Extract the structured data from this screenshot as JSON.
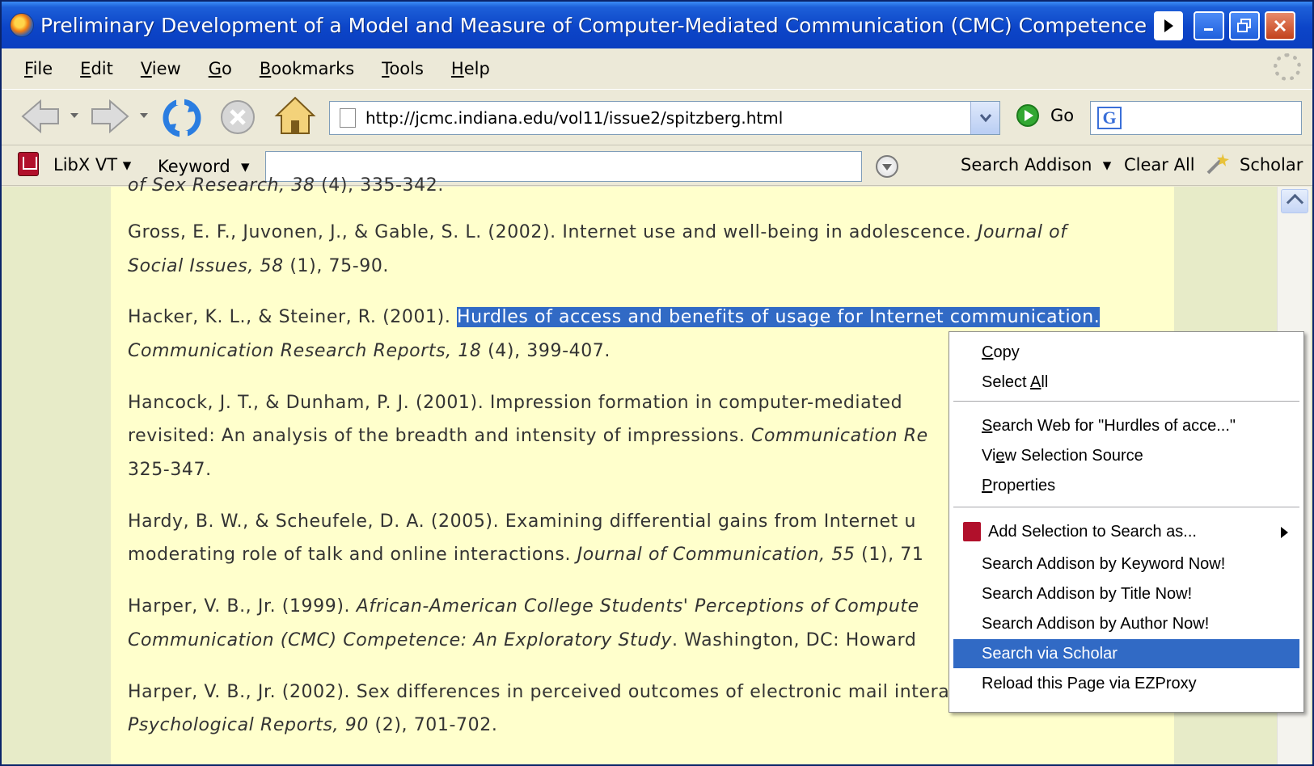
{
  "window": {
    "title": "Preliminary Development of a Model and Measure of Computer-Mediated Communication (CMC) Competence - M"
  },
  "menubar": {
    "items": [
      {
        "label": "File",
        "accel": "F",
        "rest": "ile"
      },
      {
        "label": "Edit",
        "accel": "E",
        "rest": "dit"
      },
      {
        "label": "View",
        "accel": "V",
        "rest": "iew"
      },
      {
        "label": "Go",
        "accel": "G",
        "rest": "o"
      },
      {
        "label": "Bookmarks",
        "accel": "B",
        "rest": "ookmarks"
      },
      {
        "label": "Tools",
        "accel": "T",
        "rest": "ools"
      },
      {
        "label": "Help",
        "accel": "H",
        "rest": "elp"
      }
    ]
  },
  "navbar": {
    "url": "http://jcmc.indiana.edu/vol11/issue2/spitzberg.html",
    "go_label": "Go",
    "google_icon_letter": "G"
  },
  "libx": {
    "edition": "LibX VT",
    "search_type": "Keyword",
    "search_value": "",
    "catalog_button": "Search Addison",
    "clear_all": "Clear All",
    "scholar": "Scholar"
  },
  "content": {
    "refs": [
      {
        "pre": "",
        "sel": "",
        "mid": "",
        "it": "of Sex Research, 38",
        "post": " (4), 335-342."
      },
      {
        "pre": "Gross, E. F., Juvonen, J., & Gable, S. L. (2002). Internet use and well-being in adolescence. ",
        "sel": "",
        "mid": "",
        "it": "Journal of",
        "post": ""
      },
      {
        "pre": "",
        "sel": "",
        "mid": "",
        "it": "Social Issues, 58",
        "post": " (1), 75-90."
      },
      {
        "pre": "Hacker, K. L., & Steiner, R. (2001). ",
        "sel": "Hurdles of access and benefits of usage for Internet communication.",
        "mid": "",
        "it": "",
        "post": ""
      },
      {
        "pre": "",
        "sel": "",
        "mid": "",
        "it": "Communication Research Reports, 18",
        "post": " (4), 399-407."
      },
      {
        "pre": "Hancock, J. T., & Dunham, P. J. (2001). Impression formation in computer-mediated",
        "sel": "",
        "mid": "",
        "it": "",
        "post": ""
      },
      {
        "pre": "revisited: An analysis of the breadth and intensity of impressions. ",
        "sel": "",
        "mid": "",
        "it": "Communication Re",
        "post": ""
      },
      {
        "pre": "325-347.",
        "sel": "",
        "mid": "",
        "it": "",
        "post": ""
      },
      {
        "pre": "Hardy, B. W., & Scheufele, D. A. (2005). Examining differential gains from Internet u",
        "sel": "",
        "mid": "",
        "it": "",
        "post": ""
      },
      {
        "pre": "moderating role of talk and online interactions. ",
        "sel": "",
        "mid": "",
        "it": "Journal of Communication, 55",
        "post": " (1), 71"
      },
      {
        "pre": "Harper, V. B., Jr. (1999). ",
        "sel": "",
        "mid": "",
        "it": "African-American College Students' Perceptions of Compute",
        "post": ""
      },
      {
        "pre": "",
        "sel": "",
        "mid": "",
        "it": "Communication (CMC) Competence: An Exploratory Study",
        "post": ". Washington, DC: Howard"
      },
      {
        "pre": "Harper, V. B., Jr. (2002). Sex differences in perceived outcomes of electronic mail interactions.",
        "sel": "",
        "mid": "",
        "it": "",
        "post": ""
      },
      {
        "pre": "",
        "sel": "",
        "mid": "",
        "it": "Psychological Reports, 90",
        "post": " (2), 701-702."
      }
    ]
  },
  "context_menu": {
    "items": [
      {
        "accel": "C",
        "rest": "opy",
        "label": "Copy"
      },
      {
        "pre": "Select ",
        "accel": "A",
        "rest": "ll",
        "label": "Select All"
      },
      {
        "accel": "S",
        "rest": "earch Web for \"Hurdles of acce...\"",
        "label": "Search Web for \"Hurdles of acce...\""
      },
      {
        "pre": "Vi",
        "accel": "e",
        "rest": "w Selection Source",
        "label": "View Selection Source"
      },
      {
        "accel": "P",
        "rest": "roperties",
        "label": "Properties"
      },
      {
        "label": "Add Selection to Search as..."
      },
      {
        "label": "Search Addison by Keyword Now!"
      },
      {
        "label": "Search Addison by Title Now!"
      },
      {
        "label": "Search Addison by Author Now!"
      },
      {
        "label": "Search via Scholar"
      },
      {
        "label": "Reload this Page via EZProxy"
      }
    ],
    "highlighted": "Search via Scholar"
  }
}
